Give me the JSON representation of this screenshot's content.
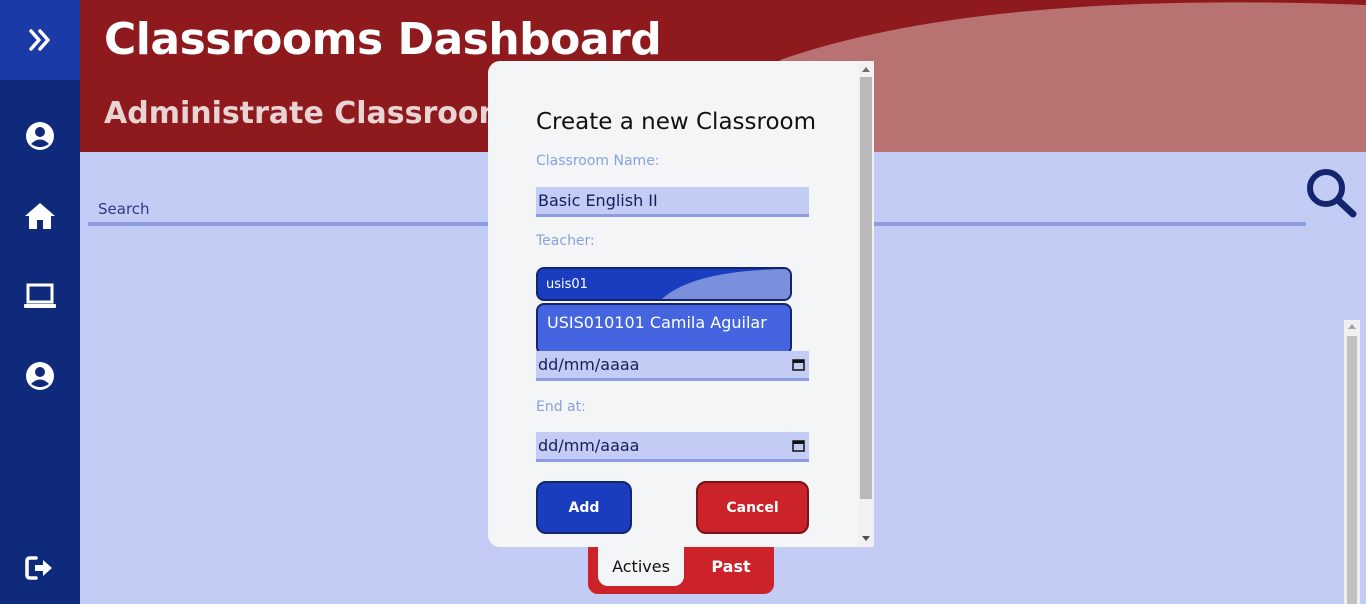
{
  "header": {
    "title": "Classrooms Dashboard",
    "subtitle": "Administrate Classrooms"
  },
  "sidebar": {
    "items": [
      {
        "icon": "expand-icon"
      },
      {
        "icon": "user-circle-icon"
      },
      {
        "icon": "home-icon"
      },
      {
        "icon": "laptop-icon"
      },
      {
        "icon": "user-circle-icon"
      },
      {
        "icon": "sign-out-icon"
      }
    ]
  },
  "search": {
    "placeholder": "Search",
    "icon": "search-icon"
  },
  "tabs": {
    "actives": "Actives",
    "past": "Past"
  },
  "modal": {
    "title": "Create a new Classroom",
    "name_label": "Classroom Name:",
    "name_value": "Basic English II",
    "teacher_label": "Teacher:",
    "teacher_value": "usis01",
    "teacher_option": "USIS010101 Camila Aguilar",
    "start_value": "dd/mm/aaaa",
    "end_label": "End at:",
    "end_value": "dd/mm/aaaa",
    "add_label": "Add",
    "cancel_label": "Cancel"
  },
  "colors": {
    "sidebar": "#0f2a7a",
    "header": "#8e1a1e",
    "background": "#c2ccf5",
    "primary": "#1a3cbf",
    "danger": "#cc2229"
  }
}
